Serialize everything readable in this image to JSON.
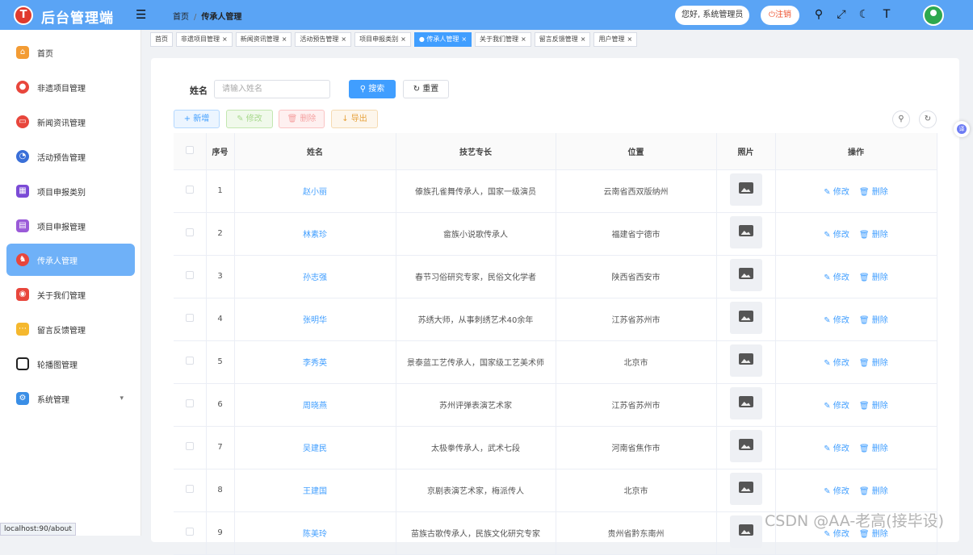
{
  "app": {
    "logo_letter": "T",
    "title": "后台管理端",
    "toggle_icon": "menu-fold-icon"
  },
  "breadcrumb": {
    "home": "首页",
    "separator": "/",
    "current": "传承人管理"
  },
  "header": {
    "greeting": "您好, 系统管理员",
    "logout": "注销"
  },
  "sidebar": {
    "items": [
      {
        "label": "首页",
        "icon": "home-icon",
        "color": "#f39c34"
      },
      {
        "label": "非遗项目管理",
        "icon": "project-icon",
        "color": "#e8463c"
      },
      {
        "label": "新闻资讯管理",
        "icon": "news-icon",
        "color": "#e8463c"
      },
      {
        "label": "活动预告管理",
        "icon": "calendar-icon",
        "color": "#3a6fd8"
      },
      {
        "label": "项目申报类别",
        "icon": "category-icon",
        "color": "#7b4bd6"
      },
      {
        "label": "项目申报管理",
        "icon": "report-icon",
        "color": "#9a5ad8"
      },
      {
        "label": "传承人管理",
        "icon": "person-icon",
        "color": "#e8463c"
      },
      {
        "label": "关于我们管理",
        "icon": "about-icon",
        "color": "#e8463c"
      },
      {
        "label": "留言反馈管理",
        "icon": "message-icon",
        "color": "#f5b82e"
      },
      {
        "label": "轮播图管理",
        "icon": "carousel-icon",
        "color": "#222222"
      },
      {
        "label": "系统管理",
        "icon": "settings-icon",
        "color": "#3a8ee6"
      }
    ],
    "active_index": 6,
    "status_url": "localhost:90/about"
  },
  "tabs": [
    {
      "label": "首页",
      "closable": false
    },
    {
      "label": "非遗项目管理",
      "closable": true
    },
    {
      "label": "新闻资讯管理",
      "closable": true
    },
    {
      "label": "活动预告管理",
      "closable": true
    },
    {
      "label": "项目申报类别",
      "closable": true
    },
    {
      "label": "传承人管理",
      "closable": true,
      "active": true
    },
    {
      "label": "关于我们管理",
      "closable": true
    },
    {
      "label": "留言反馈管理",
      "closable": true
    },
    {
      "label": "用户管理",
      "closable": true
    }
  ],
  "search": {
    "label": "姓名",
    "placeholder": "请输入姓名",
    "search_btn": "搜索",
    "reset_btn": "重置"
  },
  "toolbar": {
    "add": "新增",
    "edit": "修改",
    "delete": "删除",
    "export": "导出"
  },
  "table": {
    "headers": [
      "序号",
      "姓名",
      "技艺专长",
      "位置",
      "照片",
      "操作"
    ],
    "edit_label": "修改",
    "delete_label": "删除",
    "rows": [
      {
        "no": "1",
        "name": "赵小丽",
        "skill": "傣族孔雀舞传承人，国家一级演员",
        "location": "云南省西双版纳州"
      },
      {
        "no": "2",
        "name": "林素珍",
        "skill": "畲族小说歌传承人",
        "location": "福建省宁德市"
      },
      {
        "no": "3",
        "name": "孙志强",
        "skill": "春节习俗研究专家，民俗文化学者",
        "location": "陕西省西安市"
      },
      {
        "no": "4",
        "name": "张明华",
        "skill": "苏绣大师，从事刺绣艺术40余年",
        "location": "江苏省苏州市"
      },
      {
        "no": "5",
        "name": "李秀英",
        "skill": "景泰蓝工艺传承人，国家级工艺美术师",
        "location": "北京市"
      },
      {
        "no": "6",
        "name": "周晓燕",
        "skill": "苏州评弹表演艺术家",
        "location": "江苏省苏州市"
      },
      {
        "no": "7",
        "name": "吴建民",
        "skill": "太极拳传承人，武术七段",
        "location": "河南省焦作市"
      },
      {
        "no": "8",
        "name": "王建国",
        "skill": "京剧表演艺术家，梅派传人",
        "location": "北京市"
      },
      {
        "no": "9",
        "name": "陈美玲",
        "skill": "苗族古歌传承人，民族文化研究专家",
        "location": "贵州省黔东南州"
      }
    ]
  },
  "floating_badge": "译",
  "watermark": "CSDN @AA-老高(接毕设)"
}
